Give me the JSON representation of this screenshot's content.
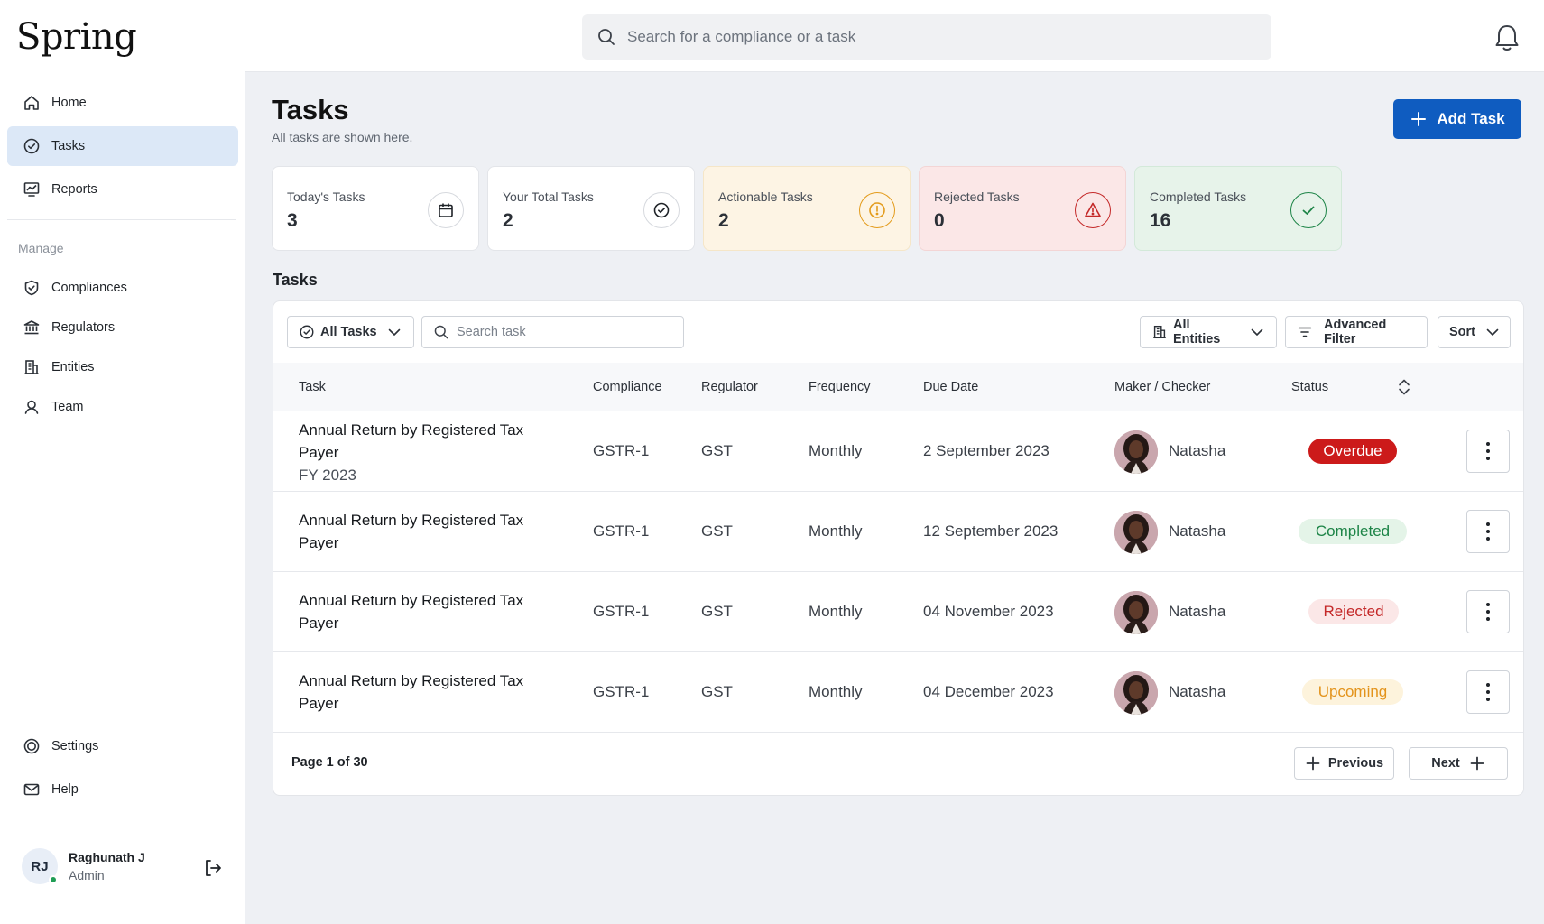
{
  "app": {
    "logo": "Spring"
  },
  "sidebar": {
    "items": [
      {
        "label": "Home",
        "icon": "home-icon"
      },
      {
        "label": "Tasks",
        "icon": "check-circle-icon",
        "active": true
      },
      {
        "label": "Reports",
        "icon": "chart-icon"
      }
    ],
    "manage_label": "Manage",
    "manage_items": [
      {
        "label": "Compliances",
        "icon": "shield-check-icon"
      },
      {
        "label": "Regulators",
        "icon": "bank-icon"
      },
      {
        "label": "Entities",
        "icon": "building-icon"
      },
      {
        "label": "Team",
        "icon": "users-icon"
      }
    ],
    "bottom_items": [
      {
        "label": "Settings",
        "icon": "gear-icon"
      },
      {
        "label": "Help",
        "icon": "mail-icon"
      }
    ],
    "profile": {
      "initials": "RJ",
      "name": "Raghunath J",
      "role": "Admin",
      "status_color": "#1f9d55"
    }
  },
  "topbar": {
    "search_placeholder": "Search for a compliance or a task"
  },
  "header": {
    "title": "Tasks",
    "subtitle": "All tasks are shown here.",
    "add_button": "Add Task",
    "accent": "#0f5cc0"
  },
  "stats": [
    {
      "label": "Today's Tasks",
      "value": "3",
      "icon": "calendar-icon"
    },
    {
      "label": "Your Total Tasks",
      "value": "2",
      "icon": "check-circle-icon"
    },
    {
      "label": "Actionable Tasks",
      "value": "2",
      "icon": "alert-circle-icon",
      "color": "#e39b1b"
    },
    {
      "label": "Rejected Tasks",
      "value": "0",
      "icon": "warning-triangle-icon",
      "color": "#c42929"
    },
    {
      "label": "Completed Tasks",
      "value": "16",
      "icon": "check-icon",
      "color": "#1d8447"
    }
  ],
  "tasks_section": {
    "title": "Tasks",
    "filter_all_tasks": "All Tasks",
    "search_placeholder": "Search task",
    "filter_entities": "All Entities",
    "advanced_filter": "Advanced Filter",
    "sort": "Sort",
    "columns": [
      "Task",
      "Compliance",
      "Regulator",
      "Frequency",
      "Due Date",
      "Maker / Checker",
      "Status"
    ],
    "rows": [
      {
        "task_line1": "Annual Return by Registered Tax",
        "task_line2": "Payer",
        "task_sub": "FY 2023",
        "compliance": "GSTR-1",
        "regulator": "GST",
        "frequency": "Monthly",
        "due_date": "2 September 2023",
        "maker": "Natasha",
        "status": "Overdue"
      },
      {
        "task_line1": "Annual Return by Registered Tax",
        "task_line2": "Payer",
        "task_sub": "",
        "compliance": "GSTR-1",
        "regulator": "GST",
        "frequency": "Monthly",
        "due_date": "12 September 2023",
        "maker": "Natasha",
        "status": "Completed"
      },
      {
        "task_line1": "Annual Return by Registered Tax",
        "task_line2": "Payer",
        "task_sub": "",
        "compliance": "GSTR-1",
        "regulator": "GST",
        "frequency": "Monthly",
        "due_date": "04 November 2023",
        "maker": "Natasha",
        "status": "Rejected"
      },
      {
        "task_line1": "Annual Return by Registered Tax",
        "task_line2": "Payer",
        "task_sub": "",
        "compliance": "GSTR-1",
        "regulator": "GST",
        "frequency": "Monthly",
        "due_date": "04 December 2023",
        "maker": "Natasha",
        "status": "Upcoming"
      }
    ],
    "page_info": "Page 1 of 30",
    "previous": "Previous",
    "next": "Next"
  }
}
